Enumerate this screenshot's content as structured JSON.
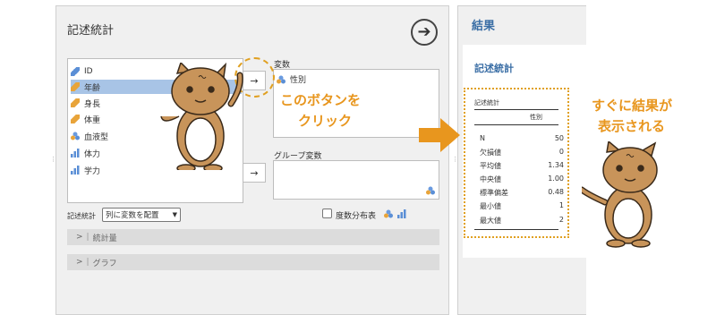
{
  "left": {
    "title": "記述統計",
    "run_icon": "arrow-circle-icon",
    "variables": [
      {
        "label": "ID",
        "icon": "pencil-blue"
      },
      {
        "label": "年齢",
        "icon": "pencil-orange",
        "selected": true
      },
      {
        "label": "身長",
        "icon": "pencil-orange"
      },
      {
        "label": "体重",
        "icon": "pencil-orange"
      },
      {
        "label": "血液型",
        "icon": "nominal"
      },
      {
        "label": "体力",
        "icon": "bars"
      },
      {
        "label": "学力",
        "icon": "bars"
      }
    ],
    "move_arrow": "→",
    "variables_label": "変数",
    "variables_box_items": [
      {
        "label": "性別",
        "icon": "nominal"
      }
    ],
    "group_label": "グループ変数",
    "stats_label": "記述統計",
    "select_value": "列に変数を配置",
    "freq_table_label": "度数分布表",
    "sections": [
      "統計量",
      "グラフ"
    ]
  },
  "right": {
    "title": "結果",
    "subtitle": "記述統計",
    "table": {
      "title": "記述統計",
      "col_header": "性別",
      "rows": [
        {
          "label": "N",
          "value": "50"
        },
        {
          "label": "欠損値",
          "value": "0"
        },
        {
          "label": "平均値",
          "value": "1.34"
        },
        {
          "label": "中央値",
          "value": "1.00"
        },
        {
          "label": "標準偏差",
          "value": "0.48"
        },
        {
          "label": "最小値",
          "value": "1"
        },
        {
          "label": "最大値",
          "value": "2"
        }
      ]
    }
  },
  "annotations": {
    "click_line1": "このボタンを",
    "click_line2": "クリック",
    "result_line1": "すぐに結果が",
    "result_line2": "表示される"
  },
  "colors": {
    "accent_orange": "#e8961e",
    "selection_blue": "#a8c4e6",
    "cat_body": "#c8945a"
  }
}
